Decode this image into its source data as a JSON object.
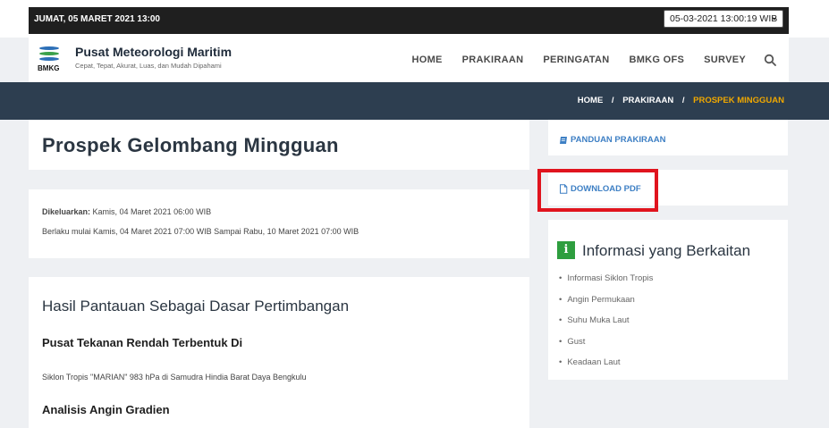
{
  "topbar": {
    "date_text": "JUMAT, 05 MARET 2021 13:00",
    "time_select_value": "05-03-2021 13:00:19 WIB"
  },
  "header": {
    "logo_text": "BMKG",
    "title": "Pusat Meteorologi Maritim",
    "tagline": "Cepat, Tepat, Akurat, Luas, dan Mudah Dipahami",
    "nav": [
      "HOME",
      "PRAKIRAAN",
      "PERINGATAN",
      "BMKG OFS",
      "SURVEY"
    ],
    "search_icon": "search-icon"
  },
  "breadcrumb": {
    "items": [
      "HOME",
      "PRAKIRAAN",
      "PROSPEK MINGGUAN"
    ],
    "separator": "/"
  },
  "main": {
    "title": "Prospek Gelombang Mingguan",
    "issued_label": "Dikeluarkan:",
    "issued_value": " Kamis, 04 Maret 2021 06:00 WIB",
    "valid_text": "Berlaku mulai Kamis, 04 Maret 2021 07:00 WIB Sampai Rabu, 10 Maret 2021 07:00 WIB",
    "section_title": "Hasil Pantauan Sebagai Dasar Pertimbangan",
    "low_pressure_heading": "Pusat Tekanan Rendah Terbentuk Di",
    "low_pressure_text": "Siklon Tropis \"MARIAN\" 983 hPa di Samudra Hindia Barat Daya Bengkulu",
    "wind_heading": "Analisis Angin Gradien"
  },
  "sidebar": {
    "guide_link": "PANDUAN PRAKIRAAN",
    "download_link": "DOWNLOAD PDF",
    "related_icon_text": "i",
    "related_title": "Informasi yang Berkaitan",
    "related_items": [
      "Informasi Siklon Tropis",
      "Angin Permukaan",
      "Suhu Muka Laut",
      "Gust",
      "Keadaan Laut"
    ]
  },
  "colors": {
    "band": "#2d3e50",
    "accent": "#f0a800",
    "link": "#3d7fc4",
    "highlight": "#e0141e",
    "info": "#2e9e3f"
  }
}
